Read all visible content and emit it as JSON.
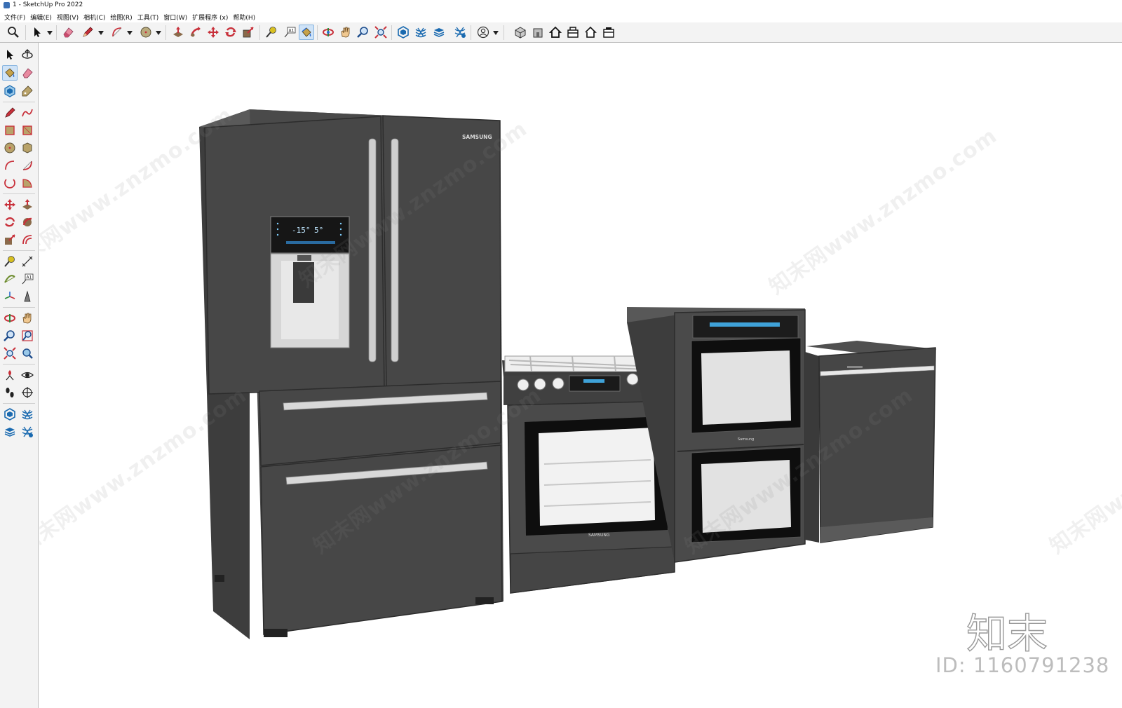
{
  "window": {
    "title": "1 - SketchUp Pro 2022"
  },
  "menubar": [
    {
      "label": "文件(F)"
    },
    {
      "label": "编辑(E)"
    },
    {
      "label": "视图(V)"
    },
    {
      "label": "相机(C)"
    },
    {
      "label": "绘图(R)"
    },
    {
      "label": "工具(T)"
    },
    {
      "label": "窗口(W)"
    },
    {
      "label": "扩展程序 (x)"
    },
    {
      "label": "帮助(H)"
    }
  ],
  "toolbar": {
    "active_tool": "paint-bucket",
    "items": [
      "zoom",
      "select",
      "eraser",
      "pencil",
      "arc",
      "circle",
      "push-pull",
      "follow-me",
      "move",
      "rotate",
      "scale",
      "tape-measure",
      "text",
      "paint-bucket",
      "orbit",
      "pan",
      "zoom-window",
      "zoom-extents",
      "components",
      "sandbox",
      "layers",
      "tags",
      "account",
      "iso-view",
      "front-view",
      "top-view",
      "right-view",
      "back-view",
      "left-view"
    ]
  },
  "model": {
    "brand_labels": {
      "fridge": "SAMSUNG",
      "range": "SAMSUNG",
      "oven": "Samsung"
    },
    "fridge_display": {
      "freezer_temp": "-15°",
      "fridge_temp": "5°"
    },
    "colors": {
      "appliance_body": "#4a4a4a",
      "appliance_dark": "#3a3a3a",
      "handle": "#d8d8d8",
      "window_glass": "#e6e6e6"
    }
  },
  "watermark": {
    "text": "知末网www.znzmo.com",
    "logo": "知末",
    "id": "ID: 1160791238"
  }
}
